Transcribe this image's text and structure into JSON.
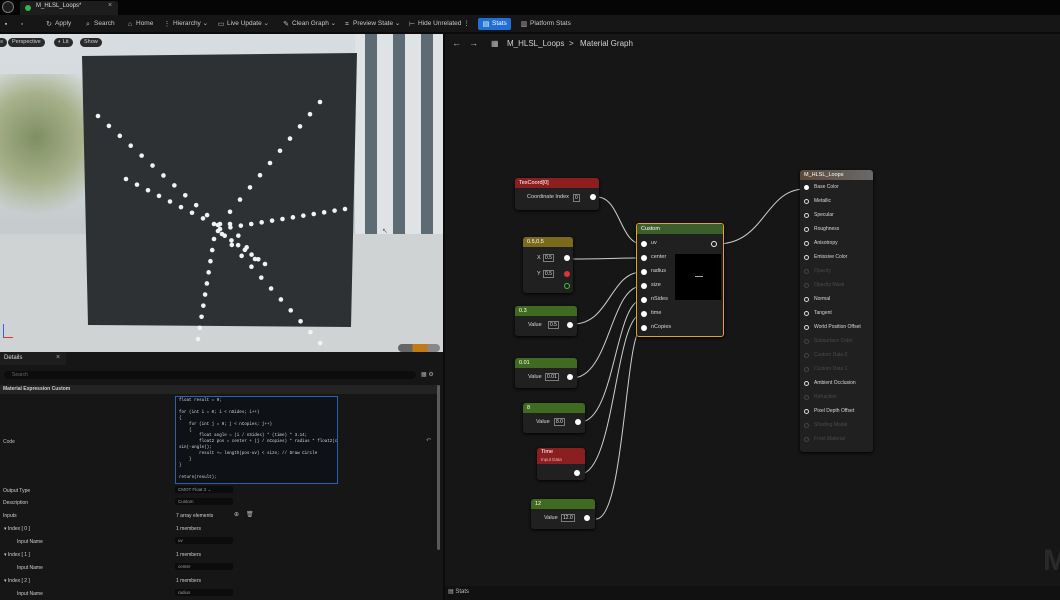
{
  "window": {
    "tab_label": "M_HLSL_Loops*"
  },
  "toolbar": {
    "apply": "Apply",
    "search": "Search",
    "home": "Home",
    "hierarchy": "Hierarchy",
    "live_update": "Live Update",
    "clean_graph": "Clean Graph",
    "preview_state": "Preview State",
    "hide_unrelated": "Hide Unrelated",
    "stats": "Stats",
    "platform_stats": "Platform Stats"
  },
  "viewport": {
    "perspective": "Perspective",
    "lit": "Lit",
    "show": "Show"
  },
  "details": {
    "tab": "Details",
    "search_placeholder": "Search",
    "section": "Material Expression Custom",
    "code_label": "Code",
    "code_lines": [
      "float result = 0;",
      "",
      "for (int i = 0; i < nSides; i++)",
      "{",
      "    for (int j = 0; j < nCopies; j++)",
      "    {",
      "        float angle = (i / nSides) * (time) * 3.14;",
      "        float2 pos = center + (j / nCopies) * radius * float2(cos(-angle),",
      "sin(-angle));",
      "        result += length(pos-uv) < size; // Draw Circle",
      "    }",
      "}",
      "",
      "return(result);"
    ],
    "output_type_label": "Output Type",
    "output_type_value": "CMOT Float 3",
    "description_label": "Description",
    "description_value": "Custom",
    "inputs_label": "Inputs",
    "inputs_value": "7 array elements",
    "index0": "Index [ 0 ]",
    "index1": "Index [ 1 ]",
    "index2": "Index [ 2 ]",
    "members": "1 members",
    "input_name_label": "Input Name",
    "input0": "uv",
    "input1": "center",
    "input2": "radius"
  },
  "graph": {
    "crumb_asset": "M_HLSL_Loops",
    "crumb_sep": ">",
    "crumb_graph": "Material Graph",
    "watermark": "M",
    "texcoord": {
      "title": "TexCoord[0]",
      "label": "Coordinate Index",
      "value": "0"
    },
    "vec2": {
      "title": "0.5,0.5",
      "x_label": "X",
      "x_value": "0.5",
      "y_label": "Y",
      "y_value": "0.5"
    },
    "const1": {
      "title": "0.3",
      "label": "Value",
      "value": "0.5"
    },
    "const2": {
      "title": "0.01",
      "label": "Value",
      "value": "0.01"
    },
    "const3": {
      "title": "8",
      "label": "Value",
      "value": "8.0"
    },
    "time": {
      "title": "Time",
      "subtitle": "Input Data"
    },
    "const4": {
      "title": "12",
      "label": "Value",
      "value": "12.0"
    },
    "custom": {
      "title": "Custom",
      "inputs": [
        "uv",
        "center",
        "radius",
        "size",
        "nSides",
        "time",
        "nCopies"
      ]
    },
    "material": {
      "title": "M_HLSL_Loops",
      "pins": [
        "Base Color",
        "Metallic",
        "Specular",
        "Roughness",
        "Anisotropy",
        "Emissive Color",
        "Opacity",
        "Opacity Mask",
        "Normal",
        "Tangent",
        "World Position Offset",
        "Subsurface Color",
        "Custom Data 0",
        "Custom Data 1",
        "Ambient Occlusion",
        "Refraction",
        "Pixel Depth Offset",
        "Shading Model",
        "Front Material"
      ],
      "active": [
        true,
        true,
        true,
        true,
        true,
        true,
        false,
        false,
        true,
        true,
        true,
        false,
        false,
        false,
        true,
        false,
        true,
        false,
        false
      ]
    }
  },
  "bottom": {
    "stats": "Stats"
  },
  "colors": {
    "accent": "#1f6fd6",
    "custom_border": "#e0a22a",
    "texcoord_header": "#8b1f1f",
    "vec2_header": "#7a6a1c",
    "const_header": "#3f6a1f",
    "time_header": "#8b1f1f"
  }
}
